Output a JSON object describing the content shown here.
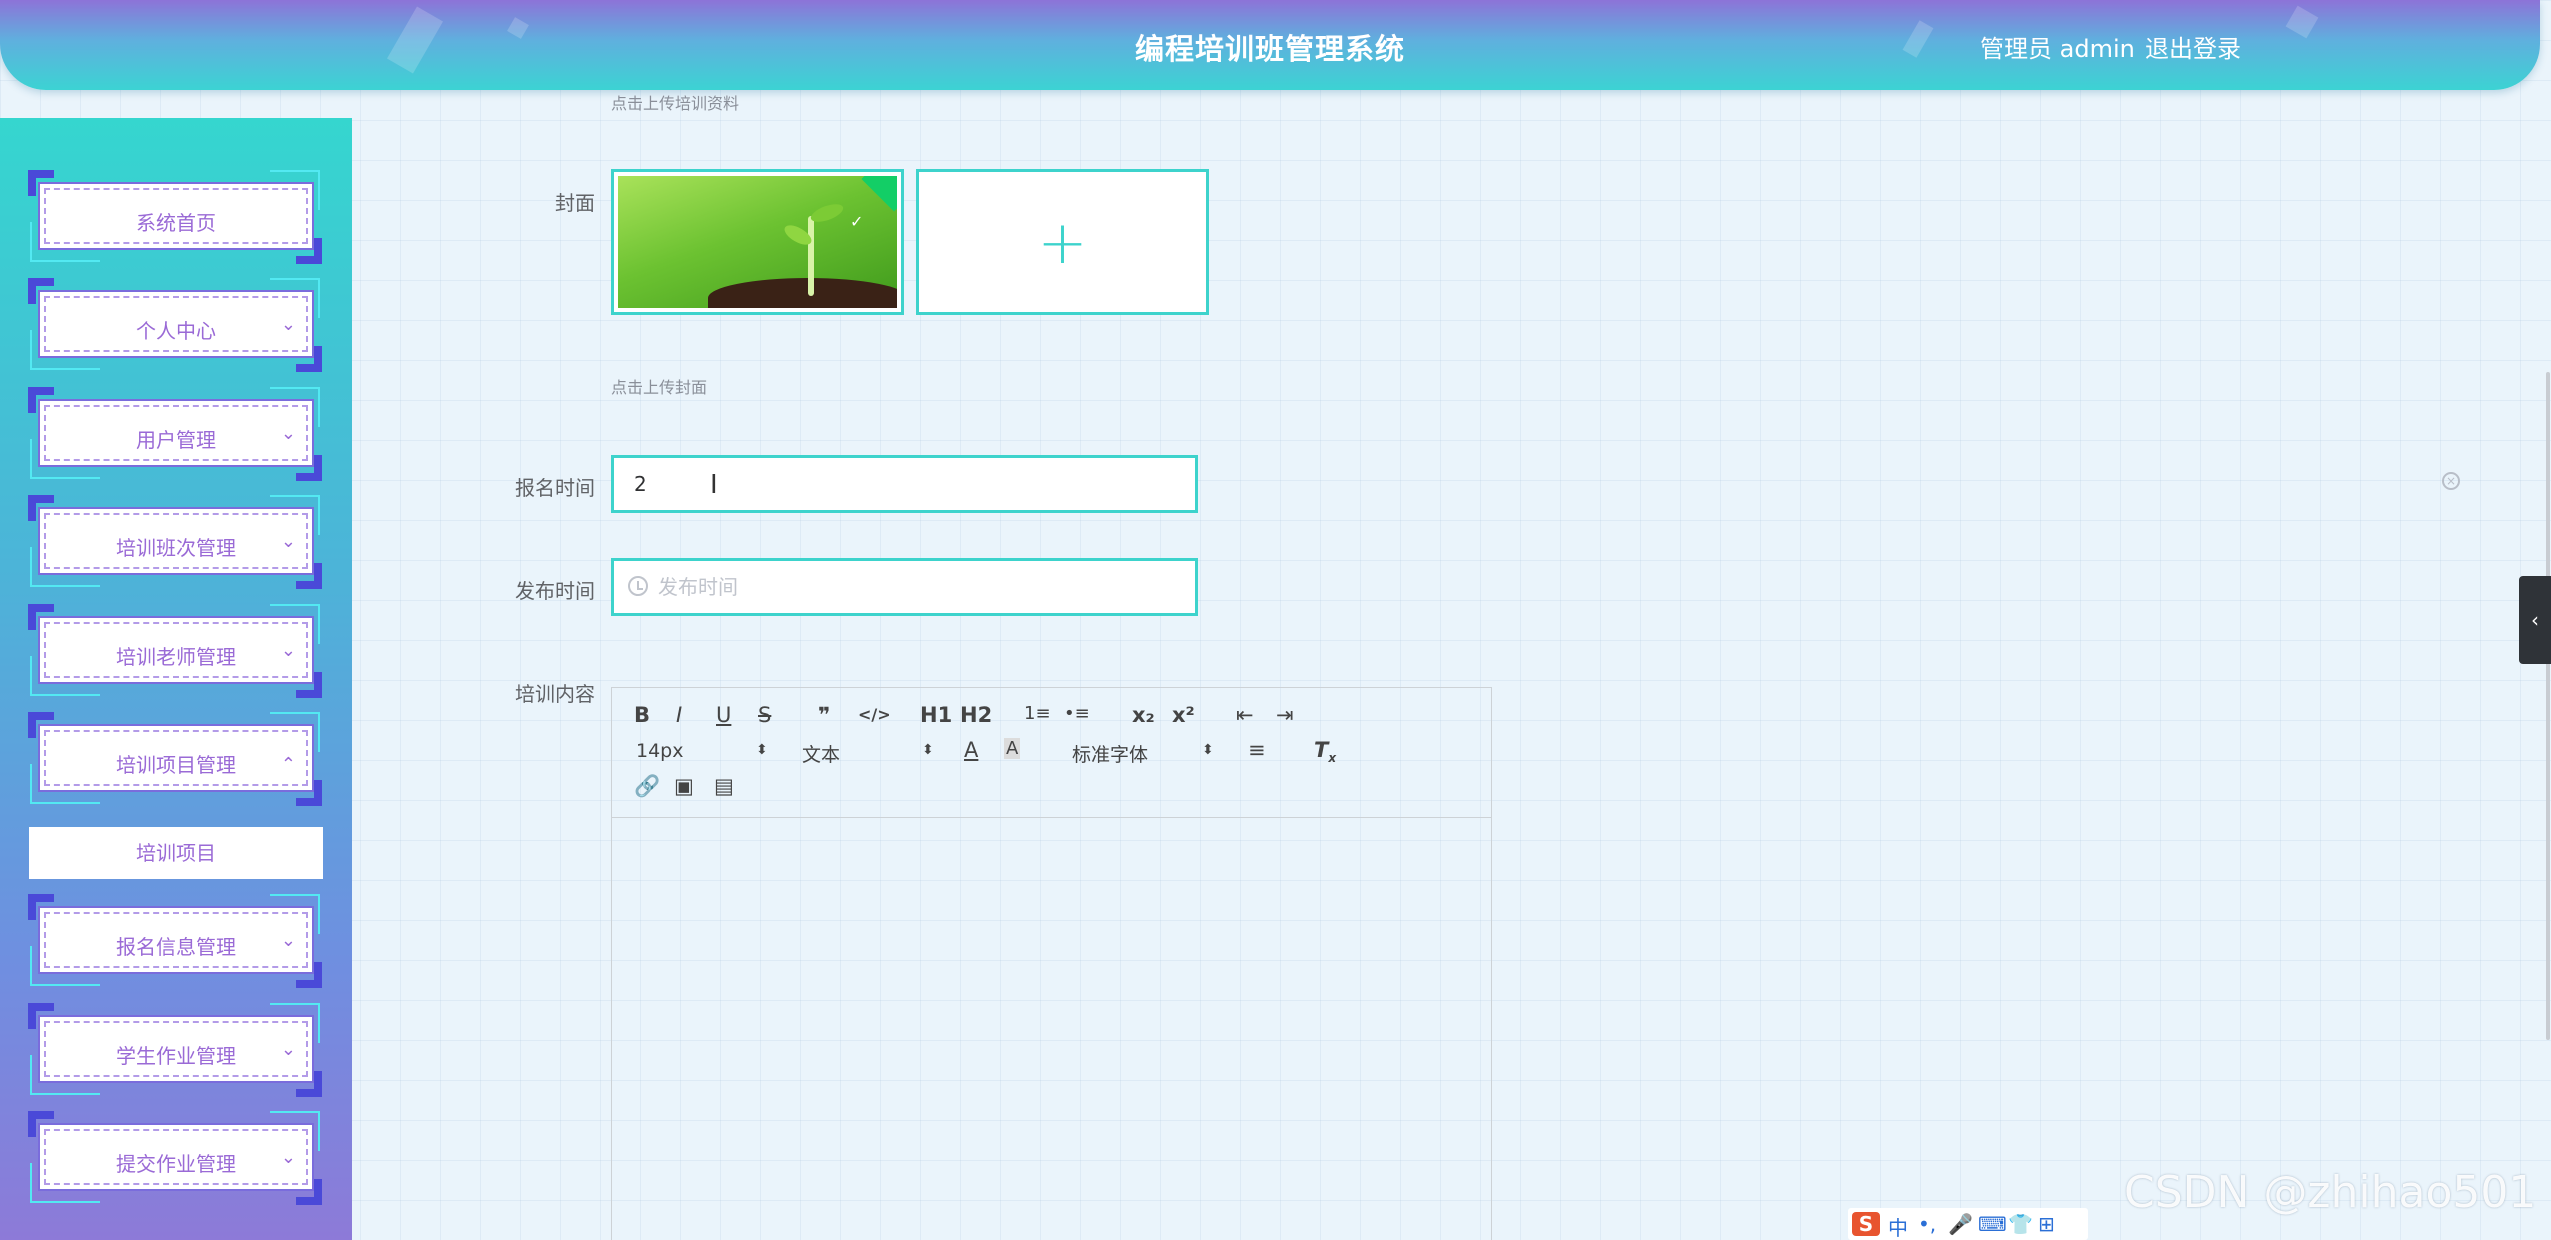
{
  "header": {
    "title": "编程培训班管理系统",
    "user": "管理员 admin",
    "logout": "退出登录"
  },
  "sidebar": {
    "items": [
      {
        "label": "系统首页",
        "arrow": ""
      },
      {
        "label": "个人中心",
        "arrow": "⌄"
      },
      {
        "label": "用户管理",
        "arrow": "⌄"
      },
      {
        "label": "培训班次管理",
        "arrow": "⌄"
      },
      {
        "label": "培训老师管理",
        "arrow": "⌄"
      },
      {
        "label": "培训项目管理",
        "arrow": "⌃"
      },
      {
        "label": "报名信息管理",
        "arrow": "⌄"
      },
      {
        "label": "学生作业管理",
        "arrow": "⌄"
      },
      {
        "label": "提交作业管理",
        "arrow": "⌄"
      }
    ],
    "submenu": {
      "label": "培训项目"
    }
  },
  "form": {
    "upload_material_tip": "点击上传培训资料",
    "cover_label": "封面",
    "upload_cover_tip": "点击上传封面",
    "signup_time_label": "报名时间",
    "signup_time_value": "2",
    "publish_time_label": "发布时间",
    "publish_time_placeholder": "发布时间",
    "content_label": "培训内容"
  },
  "editor": {
    "toolbar_row1": [
      "B",
      "I",
      "U",
      "S",
      "❞",
      "</>",
      "H1",
      "H2",
      "1≡",
      "•≡",
      "x₂",
      "x²",
      "⇤",
      "⇥"
    ],
    "font_size": "14px",
    "block_type": "文本",
    "font_family": "标准字体"
  },
  "ime": {
    "cn": "中"
  },
  "watermark": "CSDN @zhihao501"
}
